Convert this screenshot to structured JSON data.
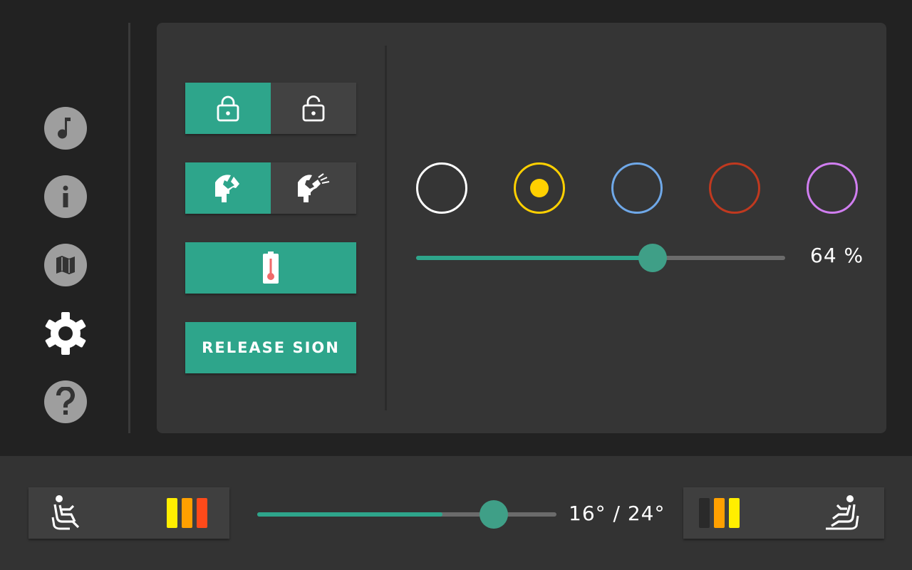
{
  "sidebar": {
    "items": [
      {
        "icon": "music-note-icon"
      },
      {
        "icon": "info-icon"
      },
      {
        "icon": "map-icon"
      },
      {
        "icon": "gear-icon",
        "active": true
      },
      {
        "icon": "help-icon"
      }
    ]
  },
  "controls": {
    "lock": {
      "left_icon": "lock-closed-icon",
      "right_icon": "lock-open-icon",
      "selected": "left"
    },
    "cabin": {
      "left_icon": "cabin-light-icon",
      "right_icon": "cabin-light-beam-icon",
      "selected": "left"
    },
    "battery_heat": {
      "icon": "battery-thermometer-icon"
    },
    "release": {
      "label": "RELEASE SION"
    }
  },
  "ambient": {
    "colors": [
      {
        "name": "white",
        "hex": "#ffffff",
        "selected": false
      },
      {
        "name": "yellow",
        "hex": "#ffd000",
        "selected": true
      },
      {
        "name": "blue",
        "hex": "#6fa8e8",
        "selected": false
      },
      {
        "name": "red",
        "hex": "#c0391f",
        "selected": false
      },
      {
        "name": "purple",
        "hex": "#d07ef0",
        "selected": false
      }
    ],
    "brightness": 64,
    "brightness_label": "64 %"
  },
  "climate": {
    "driver_seat": {
      "icon": "seat-driver-icon",
      "heat_level": 3
    },
    "passenger_seat": {
      "icon": "seat-passenger-icon",
      "heat_level": 2
    },
    "temperature_range": "16° / 24°",
    "temperature_min_fraction": 0.62,
    "temperature_max_fraction": 0.79,
    "heat_colors": [
      "#ffee00",
      "#ffa000",
      "#ff4a1a"
    ],
    "heat_off_color": "#2a2a2a"
  },
  "colors": {
    "accent": "#2ea58b",
    "panel": "#353535",
    "background": "#222222"
  }
}
